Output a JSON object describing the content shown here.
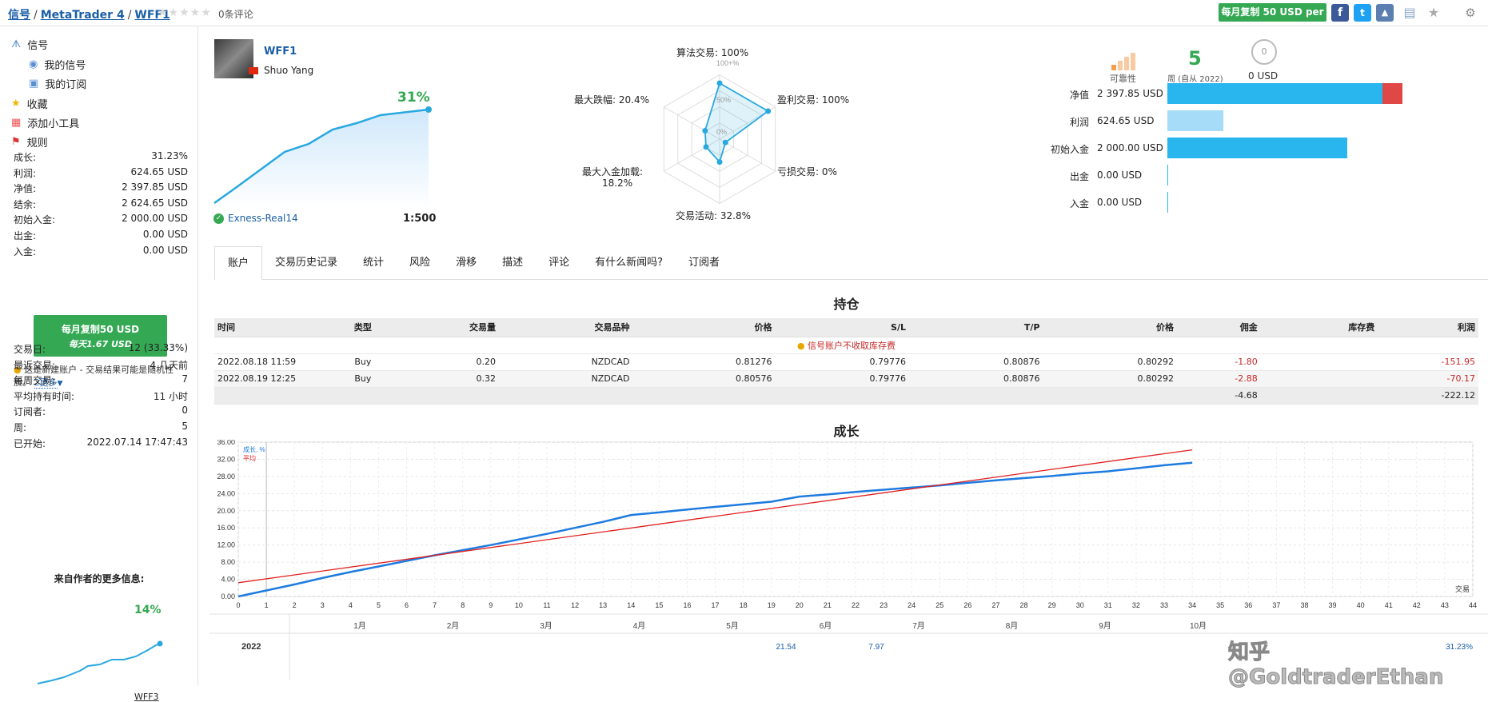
{
  "breadcrumb": {
    "signals": "信号",
    "sep": "/",
    "platform": "MetaTrader 4",
    "account": "WFF1",
    "stars": "★★★★★",
    "reviews": "0条评论"
  },
  "top": {
    "copy_button": "每月复制 50 USD per",
    "icons": [
      "facebook-icon",
      "twitter-icon",
      "education-icon",
      "bookmark-icon",
      "star-icon",
      "settings-icon"
    ]
  },
  "sidebar": {
    "menu": [
      {
        "label": "信号",
        "icon": "antenna-icon"
      },
      {
        "label": "我的信号",
        "icon": "signal-icon"
      },
      {
        "label": "我的订阅",
        "icon": "subscription-icon"
      },
      {
        "label": "收藏",
        "icon": "star-icon"
      },
      {
        "label": "添加小工具",
        "icon": "widget-icon"
      },
      {
        "label": "规则",
        "icon": "flag-icon"
      }
    ],
    "stats": [
      {
        "k": "成长:",
        "v": "31.23%"
      },
      {
        "k": "利润:",
        "v": "624.65 USD"
      },
      {
        "k": "净值:",
        "v": "2 397.85 USD"
      },
      {
        "k": "结余:",
        "v": "2 624.65 USD"
      },
      {
        "k": "初始入金:",
        "v": "2 000.00 USD"
      },
      {
        "k": "出金:",
        "v": "0.00 USD"
      },
      {
        "k": "入金:",
        "v": "0.00 USD"
      }
    ],
    "copy_btn_line1": "每月复制50 USD",
    "copy_btn_line2": "每天1.67 USD",
    "warning": "这是新建账户 - 交易结果可能是随机性质。",
    "more": "2更多",
    "stats2": [
      {
        "k": "交易日:",
        "v": "12 (33.33%)"
      },
      {
        "k": "最近交易:",
        "v": "4 几天前"
      },
      {
        "k": "每周交易:",
        "v": "7"
      },
      {
        "k": "平均持有时间:",
        "v": "11 小时"
      },
      {
        "k": "订阅者:",
        "v": "0"
      },
      {
        "k": "周:",
        "v": "5"
      },
      {
        "k": "已开始:",
        "v": "2022.07.14 17:47:43"
      }
    ],
    "more_info_title": "来自作者的更多信息:",
    "mini_growth": "14%",
    "mini_name": "WFF3"
  },
  "profile": {
    "name": "WFF1",
    "author": "Shuo Yang",
    "growth": "31%",
    "broker": "Exness-Real14",
    "leverage": "1:500"
  },
  "radar": {
    "labels": [
      "算法交易: 100%",
      "盈利交易: 100%",
      "亏损交易: 0%",
      "交易活动: 32.8%",
      "最大入金加载:",
      "18.2%",
      "最大跌幅: 20.4%"
    ],
    "rings": [
      "100+%",
      "50%",
      "0%"
    ],
    "values": [
      100,
      100,
      0,
      32.8,
      18.2,
      20.4
    ]
  },
  "summary": {
    "reliability": "可靠性",
    "weeks": "5",
    "weeks_label": "周 (自从 2022)",
    "subs": "0 USD",
    "sub_count": "0",
    "bars": [
      {
        "k": "净值",
        "v": "2 397.85 USD",
        "frac": 0.92
      },
      {
        "k": "利润",
        "v": "624.65 USD",
        "frac": 0.24
      },
      {
        "k": "初始入金",
        "v": "2 000.00 USD",
        "frac": 0.77
      },
      {
        "k": "出金",
        "v": "0.00 USD",
        "frac": 0
      },
      {
        "k": "入金",
        "v": "0.00 USD",
        "frac": 0
      }
    ]
  },
  "tabs": [
    "账户",
    "交易历史记录",
    "统计",
    "风险",
    "滑移",
    "描述",
    "评论",
    "有什么新闻吗?",
    "订阅者"
  ],
  "positions": {
    "title": "持仓",
    "headers": [
      "时间",
      "类型",
      "交易量",
      "交易品种",
      "价格",
      "S/L",
      "T/P",
      "价格",
      "佣金",
      "库存费",
      "利润"
    ],
    "notice": "信号账户不收取库存费",
    "rows": [
      [
        "2022.08.18 11:59",
        "Buy",
        "0.20",
        "NZDCAD",
        "0.81276",
        "0.79776",
        "0.80876",
        "0.80292",
        "-1.80",
        "",
        "-151.95"
      ],
      [
        "2022.08.19 12:25",
        "Buy",
        "0.32",
        "NZDCAD",
        "0.80576",
        "0.79776",
        "0.80876",
        "0.80292",
        "-2.88",
        "",
        "-70.17"
      ]
    ],
    "totals": {
      "commission": "-4.68",
      "profit": "-222.12"
    }
  },
  "chart_data": {
    "type": "line",
    "title": "成长",
    "xlabel": "交易",
    "ylim": [
      0,
      36
    ],
    "xlim": [
      0,
      44
    ],
    "yticks": [
      "0.00",
      "4.00",
      "8.00",
      "12.00",
      "16.00",
      "20.00",
      "24.00",
      "28.00",
      "32.00",
      "36.00"
    ],
    "series": [
      {
        "name": "成长, %",
        "color": "#1e7be0",
        "x": [
          0,
          1,
          2,
          3,
          4,
          5,
          6,
          7,
          8,
          9,
          10,
          11,
          12,
          13,
          14,
          15,
          16,
          17,
          18,
          19,
          20,
          21,
          22,
          23,
          24,
          25,
          26,
          27,
          28,
          29,
          30,
          31,
          32,
          33,
          34
        ],
        "values": [
          0,
          1.4,
          2.8,
          4.3,
          5.7,
          7.0,
          8.3,
          9.6,
          10.8,
          12.0,
          13.3,
          14.6,
          16.0,
          17.4,
          19.0,
          19.6,
          20.3,
          20.9,
          21.5,
          22.1,
          23.3,
          23.8,
          24.4,
          24.9,
          25.4,
          25.9,
          26.5,
          27.1,
          27.6,
          28.1,
          28.7,
          29.2,
          29.9,
          30.6,
          31.2
        ]
      },
      {
        "name": "平均",
        "color": "#e02020",
        "x": [
          0,
          34
        ],
        "values": [
          3.2,
          34.2
        ]
      }
    ],
    "months": [
      "1月",
      "2月",
      "3月",
      "4月",
      "5月",
      "6月",
      "7月",
      "8月",
      "9月",
      "10月"
    ],
    "year": "2022",
    "year_values": [
      "21.54",
      "7.97"
    ],
    "total": "31.23%"
  },
  "watermark": "知乎 @GoldtraderEthan"
}
